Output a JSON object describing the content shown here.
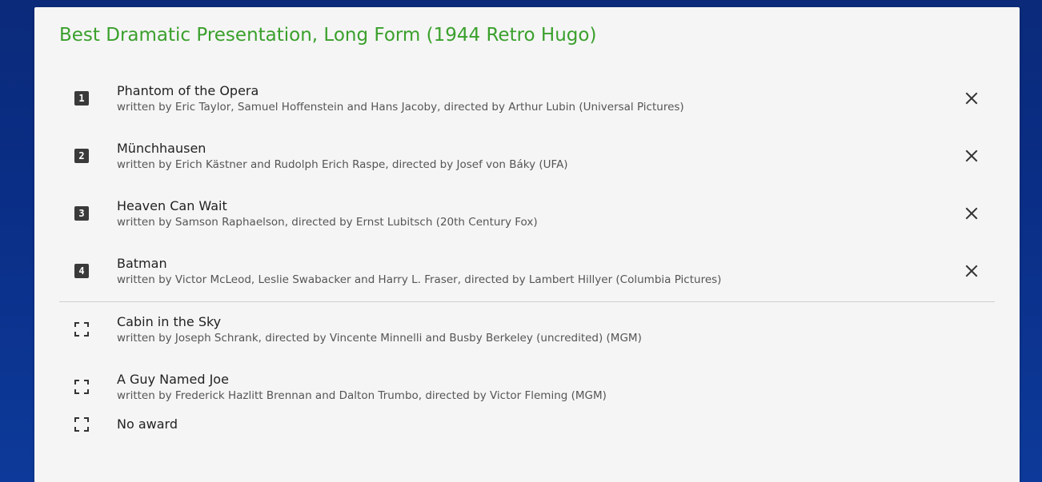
{
  "category": {
    "title": "Best Dramatic Presentation, Long Form (1944 Retro Hugo)"
  },
  "ranked": [
    {
      "rank": "1",
      "title": "Phantom of the Opera",
      "details": "written by Eric Taylor, Samuel Hoffenstein and Hans Jacoby, directed by Arthur Lubin (Universal Pictures)"
    },
    {
      "rank": "2",
      "title": "Münchhausen",
      "details": "written by Erich Kästner and Rudolph Erich Raspe, directed by Josef von Báky (UFA)"
    },
    {
      "rank": "3",
      "title": "Heaven Can Wait",
      "details": "written by Samson Raphaelson, directed by Ernst Lubitsch (20th Century Fox)"
    },
    {
      "rank": "4",
      "title": "Batman",
      "details": "written by Victor McLeod, Leslie Swabacker and Harry L. Fraser, directed by Lambert Hillyer (Columbia Pictures)"
    }
  ],
  "unranked": [
    {
      "title": "Cabin in the Sky",
      "details": "written by Joseph Schrank, directed by Vincente Minnelli and Busby Berkeley (uncredited) (MGM)"
    },
    {
      "title": "A Guy Named Joe",
      "details": "written by Frederick Hazlitt Brennan and Dalton Trumbo, directed by Victor Fleming (MGM)"
    },
    {
      "title": "No award",
      "details": ""
    }
  ],
  "icons": {
    "remove": "close-icon",
    "unranked": "select-frame-icon"
  },
  "colors": {
    "title": "#3aa02c",
    "badge": "#3a3a3a",
    "card": "#f5f5f5"
  }
}
